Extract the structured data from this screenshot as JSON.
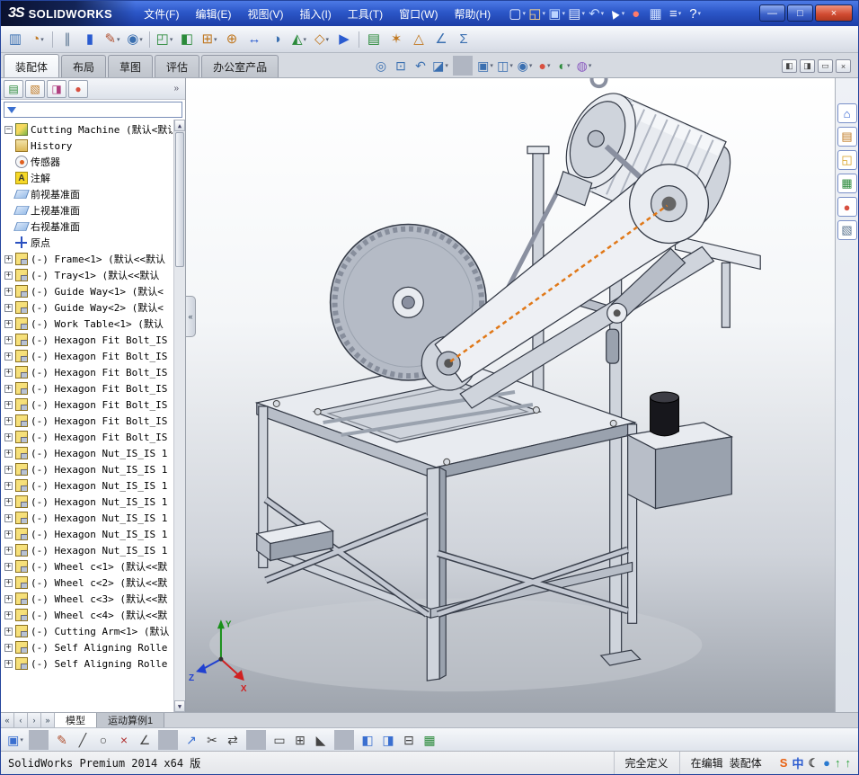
{
  "titlebar": {
    "logo_mark": "3S",
    "logo_text": "SOLIDWORKS",
    "menus": [
      "文件(F)",
      "编辑(E)",
      "视图(V)",
      "插入(I)",
      "工具(T)",
      "窗口(W)",
      "帮助(H)"
    ],
    "tools": [
      {
        "name": "new-file-button",
        "glyph": "▢",
        "color": "#eef2ff",
        "caret": "caret"
      },
      {
        "name": "open-file-button",
        "glyph": "◱",
        "color": "#ffd98a",
        "caret": "caret"
      },
      {
        "name": "save-button",
        "glyph": "▣",
        "color": "#bcd4ff",
        "caret": "caret"
      },
      {
        "name": "print-button",
        "glyph": "▤",
        "color": "#dfe8ff",
        "caret": "caret"
      },
      {
        "name": "undo-button",
        "glyph": "↶",
        "color": "#bcd4ff",
        "caret": "caret"
      },
      {
        "name": "select-cursor-button",
        "glyph": "▲",
        "color": "#ffffff",
        "caret": "caret",
        "cls": "rot"
      },
      {
        "name": "rebuild-button",
        "glyph": "●",
        "color": "#ff7a6a"
      },
      {
        "name": "file-properties-button",
        "glyph": "▦",
        "color": "#cfe0ff"
      },
      {
        "name": "options-button",
        "glyph": "≡",
        "color": "#eef2ff",
        "caret": "caret"
      },
      {
        "name": "help-button",
        "glyph": "?",
        "color": "#ffffff",
        "caret": "caret"
      }
    ],
    "window_buttons": [
      {
        "name": "minimize-button",
        "glyph": "—"
      },
      {
        "name": "maximize-button",
        "glyph": "□"
      },
      {
        "name": "close-button",
        "glyph": "×",
        "cls": "close-button"
      }
    ]
  },
  "toolbar2": {
    "items": [
      {
        "name": "viewport-settings-button",
        "glyph": "▥",
        "color": "#3a6fb0"
      },
      {
        "name": "appearance-target-button",
        "glyph": "◔",
        "color": "#c07820",
        "caret": "caret"
      },
      {
        "name": "sep"
      },
      {
        "name": "mate-references-button",
        "glyph": "∥",
        "color": "#5a7490"
      },
      {
        "name": "component-list-button",
        "glyph": "▮",
        "color": "#2a5bd0"
      },
      {
        "name": "edit-component-button",
        "glyph": "✎",
        "color": "#b05030",
        "caret": "caret"
      },
      {
        "name": "keep-visible-button",
        "glyph": "◉",
        "color": "#3a6fb0",
        "caret": "caret"
      },
      {
        "name": "sep"
      },
      {
        "name": "insert-components-button",
        "glyph": "◰",
        "color": "#2a8a3a",
        "caret": "caret"
      },
      {
        "name": "mate-button",
        "glyph": "◧",
        "color": "#2a8a3a"
      },
      {
        "name": "component-pattern-button",
        "glyph": "⊞",
        "color": "#c07820",
        "caret": "caret"
      },
      {
        "name": "smart-fasteners-button",
        "glyph": "⊕",
        "color": "#c07820"
      },
      {
        "name": "move-component-button",
        "glyph": "↔",
        "color": "#2a5bd0"
      },
      {
        "name": "show-hidden-button",
        "glyph": "◑",
        "color": "#3a6fb0"
      },
      {
        "name": "assembly-features-button",
        "glyph": "◭",
        "color": "#2a8a3a",
        "caret": "caret"
      },
      {
        "name": "reference-geometry-button",
        "glyph": "◇",
        "color": "#c07820",
        "caret": "caret"
      },
      {
        "name": "motion-study-button",
        "glyph": "▶",
        "color": "#2a5bd0"
      },
      {
        "name": "sep"
      },
      {
        "name": "bom-button",
        "glyph": "▤",
        "color": "#2a8a3a"
      },
      {
        "name": "exploded-view-button",
        "glyph": "✶",
        "color": "#c07820"
      },
      {
        "name": "interference-detection-button",
        "glyph": "△",
        "color": "#c07820"
      },
      {
        "name": "measure-button",
        "glyph": "∠",
        "color": "#3a6fb0"
      },
      {
        "name": "mass-properties-button",
        "glyph": "Σ",
        "color": "#3a6fb0"
      }
    ]
  },
  "command_bar": {
    "tabs": [
      {
        "name": "tab-assembly",
        "label": "装配体",
        "active": "active"
      },
      {
        "name": "tab-layout",
        "label": "布局"
      },
      {
        "name": "tab-sketch",
        "label": "草图"
      },
      {
        "name": "tab-evaluate",
        "label": "评估"
      },
      {
        "name": "tab-office-products",
        "label": "办公室产品"
      }
    ],
    "hud": [
      {
        "name": "zoom-fit-button",
        "glyph": "◎",
        "color": "#3a6fb0"
      },
      {
        "name": "zoom-area-button",
        "glyph": "⊡",
        "color": "#3a6fb0"
      },
      {
        "name": "previous-view-button",
        "glyph": "↶",
        "color": "#3a6fb0"
      },
      {
        "name": "section-view-button",
        "glyph": "◪",
        "color": "#3a6fb0",
        "caret": "caret"
      },
      {
        "name": "sep"
      },
      {
        "name": "view-orientation-button",
        "glyph": "▣",
        "color": "#3a6fb0",
        "caret": "caret"
      },
      {
        "name": "display-style-button",
        "glyph": "◫",
        "color": "#3a6fb0",
        "caret": "caret"
      },
      {
        "name": "hide-show-items-button",
        "glyph": "◉",
        "color": "#3a6fb0",
        "caret": "caret"
      },
      {
        "name": "edit-appearance-button",
        "glyph": "●",
        "color": "#d85040",
        "caret": "caret"
      },
      {
        "name": "apply-scene-button",
        "glyph": "◐",
        "color": "#2a8a3a",
        "caret": "caret"
      },
      {
        "name": "view-settings-button",
        "glyph": "◍",
        "color": "#8a5ac0",
        "caret": "caret"
      }
    ],
    "right_buttons": [
      {
        "name": "pane-left-button",
        "glyph": "◧"
      },
      {
        "name": "pane-right-button",
        "glyph": "◨"
      },
      {
        "name": "pane-restore-button",
        "glyph": "▭"
      },
      {
        "name": "pane-close-button",
        "glyph": "×"
      }
    ]
  },
  "feature_tree": {
    "panel_tabs": [
      {
        "name": "featuremanager-tab",
        "glyph": "▤",
        "color": "#2a8a3a"
      },
      {
        "name": "propertymanager-tab",
        "glyph": "▧",
        "color": "#c07820"
      },
      {
        "name": "configurationmanager-tab",
        "glyph": "◨",
        "color": "#b04080"
      },
      {
        "name": "appearances-tab",
        "glyph": "●",
        "color": "#d85040"
      }
    ],
    "panel_chevron": "»",
    "scroll_up": "▲",
    "scroll_down": "▼",
    "root": "Cutting Machine (默认<默认",
    "items": [
      {
        "icon": "history",
        "label": "History",
        "exp": ""
      },
      {
        "icon": "sensors",
        "label": "传感器",
        "exp": ""
      },
      {
        "icon": "annotations",
        "label": "注解",
        "exp": ""
      },
      {
        "icon": "plane",
        "label": "前视基准面",
        "exp": ""
      },
      {
        "icon": "plane",
        "label": "上视基准面",
        "exp": ""
      },
      {
        "icon": "plane",
        "label": "右视基准面",
        "exp": ""
      },
      {
        "icon": "origin",
        "label": "原点",
        "exp": ""
      },
      {
        "icon": "part",
        "label": "(-) Frame<1> (默认<<默认",
        "exp": "exp1"
      },
      {
        "icon": "part",
        "label": "(-) Tray<1> (默认<<默认",
        "exp": "exp1"
      },
      {
        "icon": "part",
        "label": "(-) Guide Way<1> (默认<",
        "exp": "exp1"
      },
      {
        "icon": "part",
        "label": "(-) Guide Way<2> (默认<",
        "exp": "exp1"
      },
      {
        "icon": "part",
        "label": "(-) Work Table<1> (默认",
        "exp": "exp1"
      },
      {
        "icon": "part",
        "label": "(-) Hexagon Fit Bolt_IS",
        "exp": "exp1"
      },
      {
        "icon": "part",
        "label": "(-) Hexagon Fit Bolt_IS",
        "exp": "exp1"
      },
      {
        "icon": "part",
        "label": "(-) Hexagon Fit Bolt_IS",
        "exp": "exp1"
      },
      {
        "icon": "part",
        "label": "(-) Hexagon Fit Bolt_IS",
        "exp": "exp1"
      },
      {
        "icon": "part",
        "label": "(-) Hexagon Fit Bolt_IS",
        "exp": "exp1"
      },
      {
        "icon": "part",
        "label": "(-) Hexagon Fit Bolt_IS",
        "exp": "exp1"
      },
      {
        "icon": "part",
        "label": "(-) Hexagon Fit Bolt_IS",
        "exp": "exp1"
      },
      {
        "icon": "part",
        "label": "(-) Hexagon Nut_IS_IS 1",
        "exp": "exp1"
      },
      {
        "icon": "part",
        "label": "(-) Hexagon Nut_IS_IS 1",
        "exp": "exp1"
      },
      {
        "icon": "part",
        "label": "(-) Hexagon Nut_IS_IS 1",
        "exp": "exp1"
      },
      {
        "icon": "part",
        "label": "(-) Hexagon Nut_IS_IS 1",
        "exp": "exp1"
      },
      {
        "icon": "part",
        "label": "(-) Hexagon Nut_IS_IS 1",
        "exp": "exp1"
      },
      {
        "icon": "part",
        "label": "(-) Hexagon Nut_IS_IS 1",
        "exp": "exp1"
      },
      {
        "icon": "part",
        "label": "(-) Hexagon Nut_IS_IS 1",
        "exp": "exp1"
      },
      {
        "icon": "part",
        "label": "(-) Wheel c<1> (默认<<默",
        "exp": "exp1"
      },
      {
        "icon": "part",
        "label": "(-) Wheel c<2> (默认<<默",
        "exp": "exp1"
      },
      {
        "icon": "part",
        "label": "(-) Wheel c<3> (默认<<默",
        "exp": "exp1"
      },
      {
        "icon": "part",
        "label": "(-) Wheel c<4> (默认<<默",
        "exp": "exp1"
      },
      {
        "icon": "part",
        "label": "(-) Cutting Arm<1> (默认",
        "exp": "exp1"
      },
      {
        "icon": "part",
        "label": "(-) Self Aligning Rolle",
        "exp": "exp1"
      },
      {
        "icon": "part",
        "label": "(-) Self Aligning Rolle",
        "exp": "exp1"
      }
    ]
  },
  "viewport": {
    "collapse_glyph": "«",
    "triad": {
      "x": "X",
      "y": "Y",
      "z": "Z"
    }
  },
  "task_pane": {
    "items": [
      {
        "name": "solidworks-resources-button",
        "glyph": "⌂",
        "color": "#2a5bd0"
      },
      {
        "name": "design-library-button",
        "glyph": "▤",
        "color": "#c07820"
      },
      {
        "name": "file-explorer-button",
        "glyph": "◱",
        "color": "#d8a020"
      },
      {
        "name": "view-palette-button",
        "glyph": "▦",
        "color": "#2a8a3a"
      },
      {
        "name": "appearances-scenes-button",
        "glyph": "●",
        "color": "#d85040"
      },
      {
        "name": "custom-properties-button",
        "glyph": "▧",
        "color": "#5a7490"
      }
    ]
  },
  "model_tabs": {
    "nav": [
      {
        "name": "first-tab-button",
        "glyph": "«"
      },
      {
        "name": "prev-tab-button",
        "glyph": "‹"
      },
      {
        "name": "next-tab-button",
        "glyph": "›"
      },
      {
        "name": "last-tab-button",
        "glyph": "»"
      }
    ],
    "tabs": [
      {
        "name": "tab-model",
        "label": "模型",
        "active": "active"
      },
      {
        "name": "tab-motion-study",
        "label": "运动算例1"
      }
    ]
  },
  "sketch_toolbar": {
    "items": [
      {
        "name": "save-button",
        "glyph": "▣",
        "color": "#3a6fd0",
        "caret": "caret"
      },
      {
        "name": "sep"
      },
      {
        "name": "sketch-button",
        "glyph": "✎",
        "color": "#b05030"
      },
      {
        "name": "line-button",
        "glyph": "╱",
        "color": "#444444"
      },
      {
        "name": "circle-button",
        "glyph": "○",
        "color": "#444444"
      },
      {
        "name": "erase-button",
        "glyph": "×",
        "color": "#b03030"
      },
      {
        "name": "smart-dimension-button",
        "glyph": "∠",
        "color": "#444444"
      },
      {
        "name": "sep"
      },
      {
        "name": "convert-entities-button",
        "glyph": "↗",
        "color": "#3a6fd0"
      },
      {
        "name": "trim-entities-button",
        "glyph": "✂",
        "color": "#444444"
      },
      {
        "name": "mirror-entities-button",
        "glyph": "⇄",
        "color": "#444444"
      },
      {
        "name": "sep"
      },
      {
        "name": "corner-rectangle-button",
        "glyph": "▭",
        "color": "#444444"
      },
      {
        "name": "linear-pattern-button",
        "glyph": "⊞",
        "color": "#444444"
      },
      {
        "name": "chamfer-button",
        "glyph": "◣",
        "color": "#444444"
      },
      {
        "name": "sep"
      },
      {
        "name": "standard-views-button",
        "glyph": "◧",
        "color": "#3a6fd0"
      },
      {
        "name": "shaded-view-button",
        "glyph": "◨",
        "color": "#3a6fd0"
      },
      {
        "name": "section-button",
        "glyph": "⊟",
        "color": "#444444"
      },
      {
        "name": "grid-snap-button",
        "glyph": "▦",
        "color": "#2a8a3a"
      }
    ]
  },
  "statusbar": {
    "app_info": "SolidWorks Premium 2014 x64 版",
    "define_state": "完全定义",
    "edit_state": "在编辑 装配体",
    "tray": [
      {
        "name": "sogou-ime-icon",
        "glyph": "S",
        "color": "#e86010"
      },
      {
        "name": "chinese-ime-icon",
        "glyph": "中",
        "color": "#2a5bd0"
      },
      {
        "name": "ime-mode-icon",
        "glyph": "☾",
        "color": "#444444"
      },
      {
        "name": "network-icon",
        "glyph": "●",
        "color": "#2a7ad0"
      },
      {
        "name": "update-icon",
        "glyph": "↑",
        "color": "#2aa03a"
      },
      {
        "name": "sync-icon",
        "glyph": "↑",
        "color": "#2aa03a"
      }
    ]
  }
}
